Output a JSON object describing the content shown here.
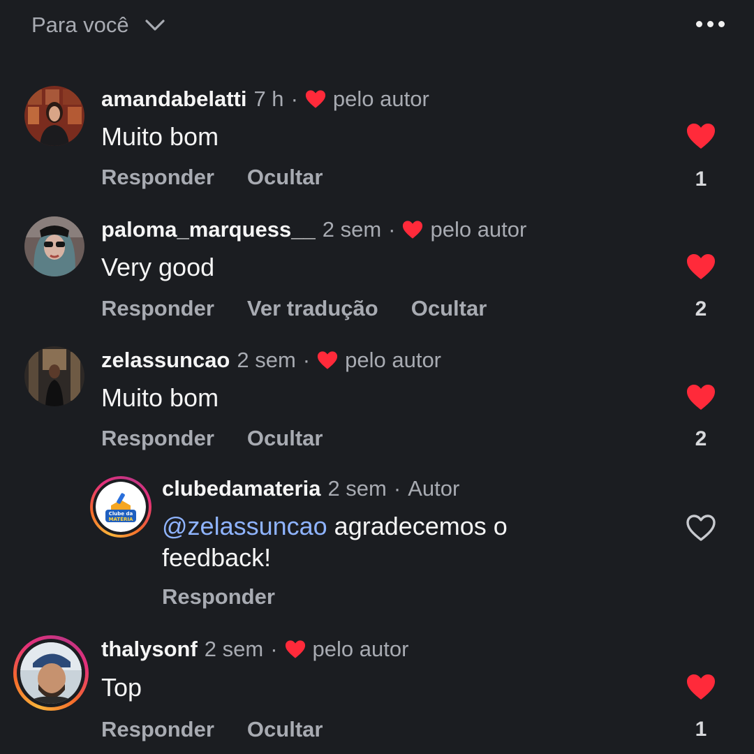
{
  "header": {
    "filter_label": "Para você"
  },
  "comments": [
    {
      "username": "amandabelatti",
      "time": "7 h",
      "liked_label": "pelo autor",
      "text": "Muito bom",
      "actions": [
        "Responder",
        "Ocultar"
      ],
      "likes": "1"
    },
    {
      "username": "paloma_marquess__",
      "time": "2 sem",
      "liked_label": "pelo autor",
      "text": "Very good",
      "actions": [
        "Responder",
        "Ver tradução",
        "Ocultar"
      ],
      "likes": "2"
    },
    {
      "username": "zelassuncao",
      "time": "2 sem",
      "liked_label": "pelo autor",
      "text": "Muito bom",
      "actions": [
        "Responder",
        "Ocultar"
      ],
      "likes": "2"
    },
    {
      "username": "thalysonf",
      "time": "2 sem",
      "liked_label": "pelo autor",
      "text": "Top",
      "actions": [
        "Responder",
        "Ocultar"
      ],
      "likes": "1"
    }
  ],
  "reply": {
    "username": "clubedamateria",
    "time": "2 sem",
    "role": "Autor",
    "mention": "@zelassuncao",
    "text_line1": " agradecemos o",
    "text_line2": "feedback!",
    "actions": [
      "Responder"
    ],
    "logo_text_line1": "Clube da",
    "logo_text_line2": "MATÉRIA"
  },
  "colors": {
    "background": "#1b1d21",
    "heart_red": "#ff2a3a",
    "mention_blue": "#8fb4ff",
    "secondary_text": "#a8abb2"
  },
  "icons": {
    "chevron": "chevron-down-icon",
    "more": "more-horizontal-icon",
    "heart": "heart-icon"
  }
}
